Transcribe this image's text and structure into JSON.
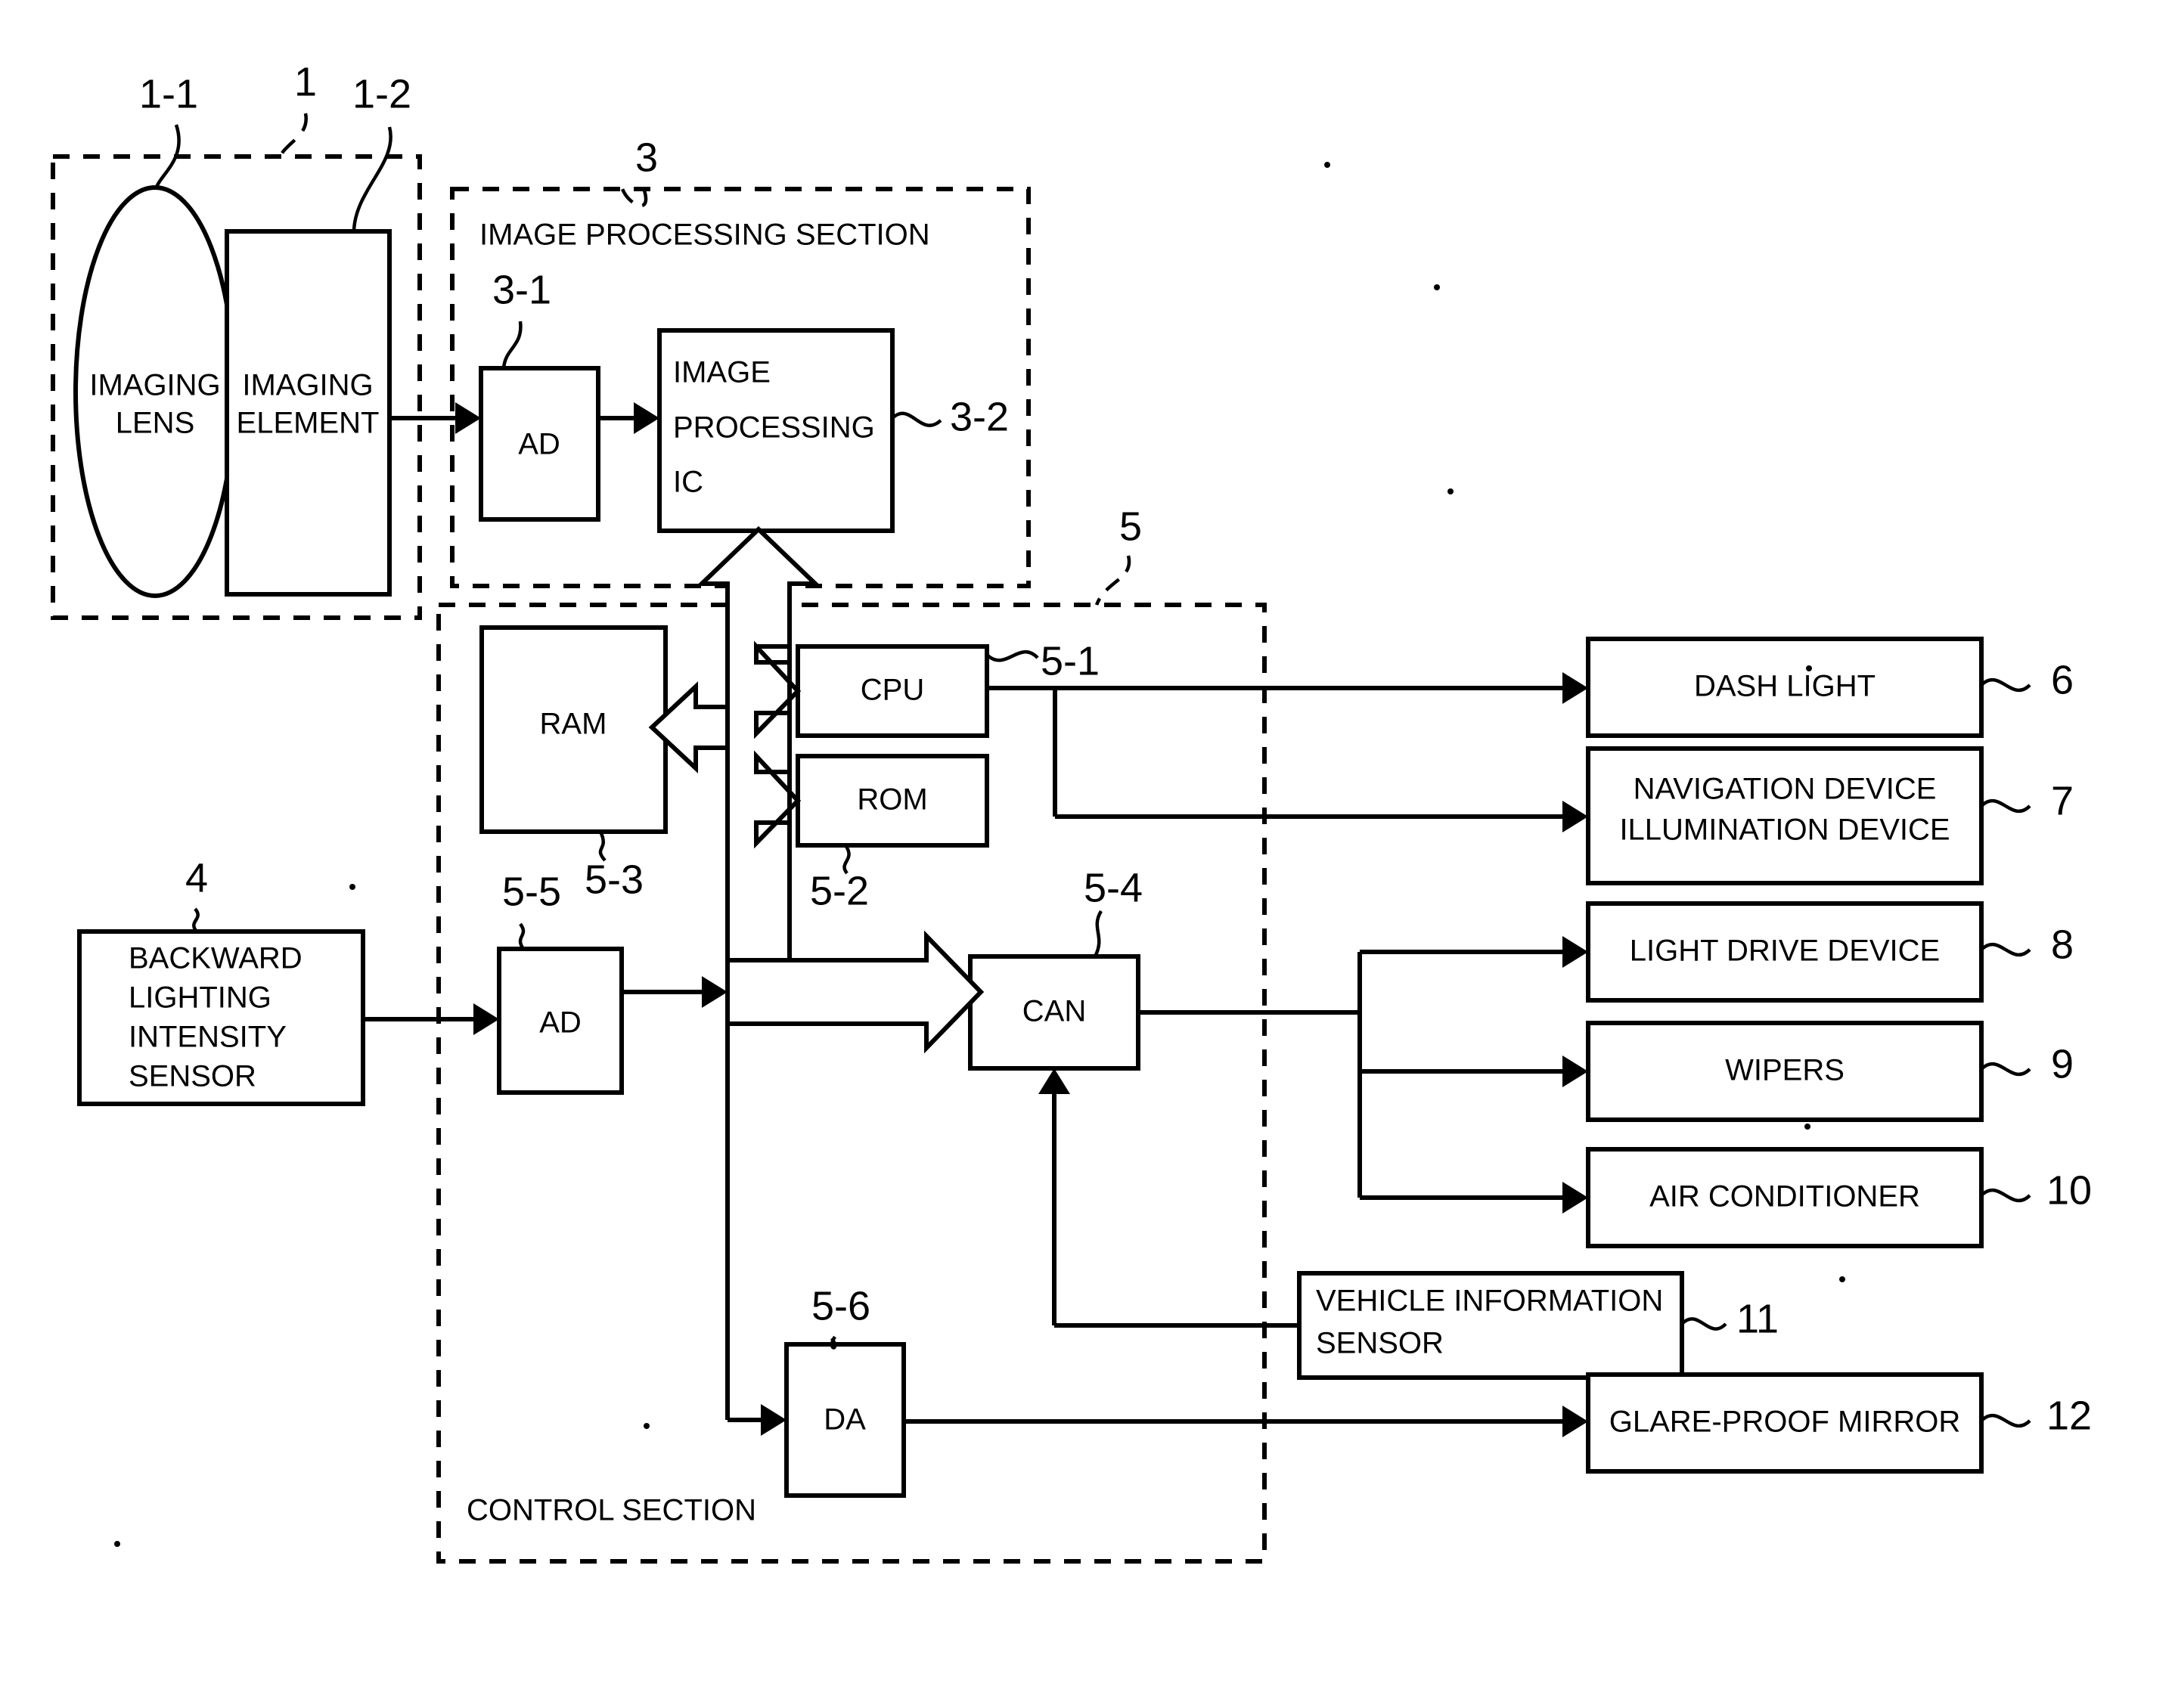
{
  "figure": {
    "type": "patent-block-diagram",
    "sections": [
      {
        "id": "camera",
        "label": "",
        "ref": "1"
      },
      {
        "id": "imgproc",
        "label": "IMAGE PROCESSING SECTION",
        "ref": "3"
      },
      {
        "id": "control",
        "label": "CONTROL SECTION",
        "ref": "5"
      }
    ],
    "blocks": [
      {
        "id": "imaging-lens",
        "label": "IMAGING\nLENS",
        "ref": "1-1"
      },
      {
        "id": "imaging-element",
        "label": "IMAGING\nELEMENT",
        "ref": "1-2"
      },
      {
        "id": "ad-image",
        "label": "AD",
        "ref": "3-1"
      },
      {
        "id": "image-processing-ic",
        "label": "IMAGE\nPROCESSING\nIC",
        "ref": "3-2"
      },
      {
        "id": "ram",
        "label": "RAM",
        "ref": "5-3"
      },
      {
        "id": "cpu",
        "label": "CPU",
        "ref": "5-1"
      },
      {
        "id": "rom",
        "label": "ROM",
        "ref": "5-2"
      },
      {
        "id": "can",
        "label": "CAN",
        "ref": "5-4"
      },
      {
        "id": "ad-sensor",
        "label": "AD",
        "ref": "5-5"
      },
      {
        "id": "da",
        "label": "DA",
        "ref": "5-6"
      },
      {
        "id": "backward-sensor",
        "label": "BACKWARD\nLIGHTING\nINTENSITY\nSENSOR",
        "ref": "4"
      },
      {
        "id": "dash-light",
        "label": "DASH LIGHT",
        "ref": "6"
      },
      {
        "id": "navigation-device",
        "label": "NAVIGATION DEVICE\nILLUMINATION DEVICE",
        "ref": "7"
      },
      {
        "id": "light-drive-device",
        "label": "LIGHT DRIVE DEVICE",
        "ref": "8"
      },
      {
        "id": "wipers",
        "label": "WIPERS",
        "ref": "9"
      },
      {
        "id": "air-conditioner",
        "label": "AIR CONDITIONER",
        "ref": "10"
      },
      {
        "id": "vehicle-info-sensor",
        "label": "VEHICLE INFORMATION\nSENSOR",
        "ref": "11"
      },
      {
        "id": "glare-proof-mirror",
        "label": "GLARE-PROOF MIRROR",
        "ref": "12"
      }
    ]
  },
  "labels": {
    "imaging_lens_l1": "IMAGING",
    "imaging_lens_l2": "LENS",
    "imaging_element_l1": "IMAGING",
    "imaging_element_l2": "ELEMENT",
    "image_processing_section": "IMAGE PROCESSING SECTION",
    "control_section": "CONTROL SECTION",
    "ad_image": "AD",
    "ipic_l1": "IMAGE",
    "ipic_l2": "PROCESSING",
    "ipic_l3": "IC",
    "ram": "RAM",
    "cpu": "CPU",
    "rom": "ROM",
    "can": "CAN",
    "ad_sensor": "AD",
    "da": "DA",
    "bls_l1": "BACKWARD",
    "bls_l2": "LIGHTING",
    "bls_l3": "INTENSITY",
    "bls_l4": "SENSOR",
    "dash_light": "DASH LIGHT",
    "nav_l1": "NAVIGATION DEVICE",
    "nav_l2": "ILLUMINATION DEVICE",
    "light_drive_device": "LIGHT DRIVE DEVICE",
    "wipers": "WIPERS",
    "air_conditioner": "AIR CONDITIONER",
    "vis_l1": "VEHICLE INFORMATION",
    "vis_l2": "SENSOR",
    "glare_proof_mirror": "GLARE-PROOF MIRROR"
  },
  "refs": {
    "r1": "1",
    "r11": "1-1",
    "r12": "1-2",
    "r3": "3",
    "r31": "3-1",
    "r32": "3-2",
    "r4": "4",
    "r5": "5",
    "r51": "5-1",
    "r52": "5-2",
    "r53": "5-3",
    "r54": "5-4",
    "r55": "5-5",
    "r56": "5-6",
    "r6": "6",
    "r7": "7",
    "r8": "8",
    "r9": "9",
    "r10": "10",
    "r11b": "11",
    "r12b": "12"
  },
  "colors": {
    "ink": "#000000",
    "paper": "#ffffff"
  }
}
